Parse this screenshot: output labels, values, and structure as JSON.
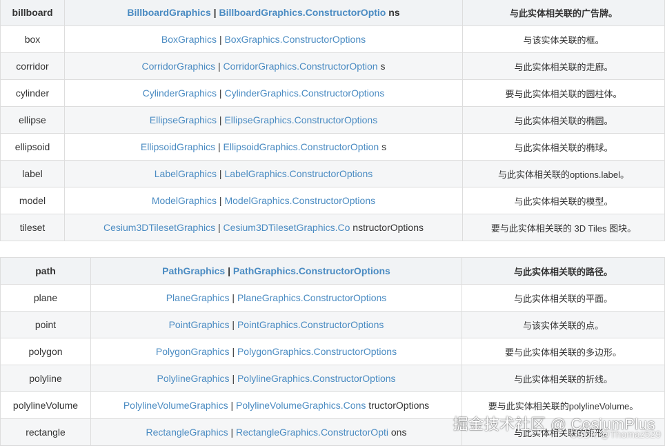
{
  "table1": [
    {
      "name": "billboard",
      "type": "BillboardGraphics",
      "options": "BillboardGraphics.ConstructorOptio",
      "options_rest": "ns",
      "desc": "与此实体相关联的广告牌。",
      "header": true
    },
    {
      "name": "box",
      "type": "BoxGraphics",
      "options": "BoxGraphics.ConstructorOptions",
      "options_rest": "",
      "desc": "与该实体关联的框。"
    },
    {
      "name": "corridor",
      "type": "CorridorGraphics",
      "options": "CorridorGraphics.ConstructorOption",
      "options_rest": "s",
      "desc": "与此实体相关联的走廊。"
    },
    {
      "name": "cylinder",
      "type": "CylinderGraphics",
      "options": "CylinderGraphics.ConstructorOptions",
      "options_rest": "",
      "desc": "要与此实体相关联的圆柱体。"
    },
    {
      "name": "ellipse",
      "type": "EllipseGraphics",
      "options": "EllipseGraphics.ConstructorOptions",
      "options_rest": "",
      "desc": "与此实体相关联的椭圆。"
    },
    {
      "name": "ellipsoid",
      "type": "EllipsoidGraphics",
      "options": "EllipsoidGraphics.ConstructorOption",
      "options_rest": "s",
      "desc": "与此实体相关联的椭球。"
    },
    {
      "name": "label",
      "type": "LabelGraphics",
      "options": "LabelGraphics.ConstructorOptions",
      "options_rest": "",
      "desc": "与此实体相关联的options.label。"
    },
    {
      "name": "model",
      "type": "ModelGraphics",
      "options": "ModelGraphics.ConstructorOptions",
      "options_rest": "",
      "desc": "与此实体相关联的模型。"
    },
    {
      "name": "tileset",
      "type": "Cesium3DTilesetGraphics",
      "options": "Cesium3DTilesetGraphics.Co",
      "options_rest": "nstructorOptions",
      "desc": "要与此实体相关联的 3D Tiles 图块。"
    }
  ],
  "table2": [
    {
      "name": "path",
      "type": "PathGraphics",
      "options": "PathGraphics.ConstructorOptions",
      "options_rest": "",
      "desc": "与此实体相关联的路径。",
      "header": true
    },
    {
      "name": "plane",
      "type": "PlaneGraphics",
      "options": "PlaneGraphics.ConstructorOptions",
      "options_rest": "",
      "desc": "与此实体相关联的平面。"
    },
    {
      "name": "point",
      "type": "PointGraphics",
      "options": "PointGraphics.ConstructorOptions",
      "options_rest": "",
      "desc": "与该实体关联的点。"
    },
    {
      "name": "polygon",
      "type": "PolygonGraphics",
      "options": "PolygonGraphics.ConstructorOptions",
      "options_rest": "",
      "desc": "要与此实体相关联的多边形。"
    },
    {
      "name": "polyline",
      "type": "PolylineGraphics",
      "options": "PolylineGraphics.ConstructorOptions",
      "options_rest": "",
      "desc": "与此实体相关联的折线。"
    },
    {
      "name": "polylineVolume",
      "type": "PolylineVolumeGraphics",
      "options": "PolylineVolumeGraphics.Cons",
      "options_rest": "tructorOptions",
      "desc": "要与此实体相关联的polylineVolume。"
    },
    {
      "name": "rectangle",
      "type": "RectangleGraphics",
      "options": "RectangleGraphics.ConstructorOpti",
      "options_rest": "ons",
      "desc": "与此实体相关联的矩形。"
    }
  ],
  "separator": "|",
  "watermark": {
    "main": "掘金技术社区 @ CesiumPlus",
    "sub": "CSDN @Thomaz529"
  }
}
